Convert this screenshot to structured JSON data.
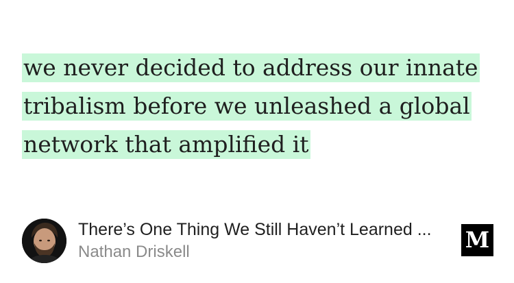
{
  "quote": {
    "lines": [
      "we never decided to address our innate",
      "tribalism before we unleashed a global",
      "network that amplified it"
    ],
    "highlight_color": "#c9f7d9"
  },
  "article": {
    "title": "There’s One Thing We Still Haven’t Learned ...",
    "author": "Nathan Driskell"
  },
  "brand": {
    "logo_letter": "M",
    "icon": "medium-logo-icon"
  },
  "avatar": {
    "icon": "author-avatar"
  }
}
